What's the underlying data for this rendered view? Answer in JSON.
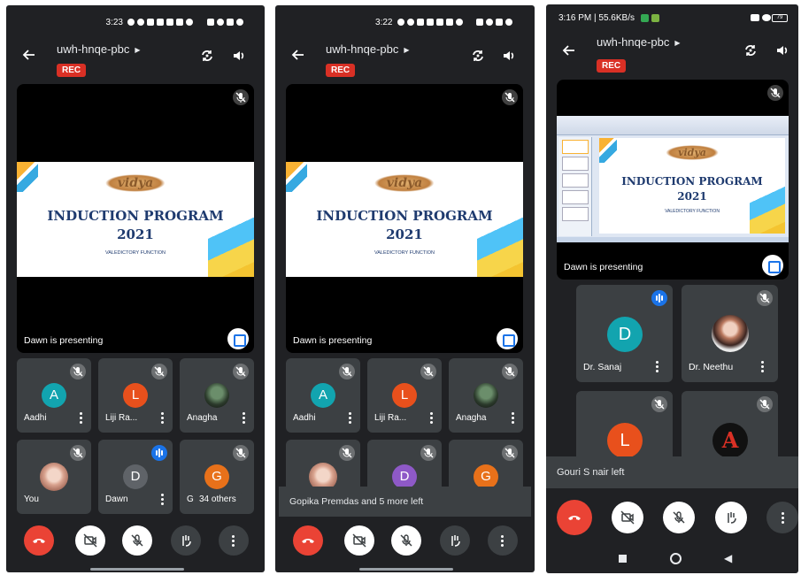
{
  "screens": [
    {
      "status_time": "3:23",
      "meeting_code": "uwh-hnqe-pbc",
      "rec": "REC",
      "slide": {
        "logo": "vidya",
        "title1": "INDUCTION PROGRAM",
        "title2": "2021",
        "subtitle": "VALEDICTORY FUNCTION"
      },
      "presenting": "Dawn is presenting",
      "tiles": [
        {
          "name": "Aadhi",
          "initial": "A",
          "color": "#12a4af"
        },
        {
          "name": "Liji Ra...",
          "initial": "L",
          "color": "#e8501c"
        },
        {
          "name": "Anagha",
          "initial": "",
          "color": ""
        },
        {
          "name": "You",
          "initial": "",
          "color": ""
        },
        {
          "name": "Dawn",
          "initial": "D",
          "color": "#5f6368"
        },
        {
          "name": "Gi",
          "initial": "G",
          "color": "#e8711a"
        }
      ],
      "others": "34 others"
    },
    {
      "status_time": "3:22",
      "meeting_code": "uwh-hnqe-pbc",
      "rec": "REC",
      "slide": {
        "logo": "vidya",
        "title1": "INDUCTION PROGRAM",
        "title2": "2021",
        "subtitle": "VALEDICTORY FUNCTION"
      },
      "presenting": "Dawn is presenting",
      "tiles": [
        {
          "name": "Aadhi",
          "initial": "A",
          "color": "#12a4af"
        },
        {
          "name": "Liji Ra...",
          "initial": "L",
          "color": "#e8501c"
        },
        {
          "name": "Anagha",
          "initial": "",
          "color": ""
        },
        {
          "name": "",
          "initial": "",
          "color": ""
        },
        {
          "name": "",
          "initial": "D",
          "color": "#8e59c7"
        },
        {
          "name": "",
          "initial": "G",
          "color": "#e8711a"
        }
      ],
      "toast": "Gopika Premdas and 5 more left"
    },
    {
      "status_time": "3:16 PM | 55.6KB/s",
      "battery": "79",
      "meeting_code": "uwh-hnqe-pbc",
      "rec": "REC",
      "slide": {
        "logo": "vidya",
        "title1": "INDUCTION PROGRAM",
        "title2": "2021",
        "subtitle": "VALEDICTORY FUNCTION"
      },
      "presenting": "Dawn is presenting",
      "tiles": [
        {
          "name": "Dr. Sanaj",
          "initial": "D",
          "color": "#12a4af"
        },
        {
          "name": "Dr. Neethu",
          "initial": "",
          "color": ""
        },
        {
          "name": "",
          "initial": "L",
          "color": "#e8501c"
        },
        {
          "name": "",
          "initial": "A",
          "color": "#d93025"
        }
      ],
      "toast": "Gouri S nair left"
    }
  ],
  "colors": {
    "background": "#202124",
    "tile": "#3c4043",
    "end_call": "#ea4335",
    "rec": "#d93025",
    "accent": "#1a73e8"
  }
}
